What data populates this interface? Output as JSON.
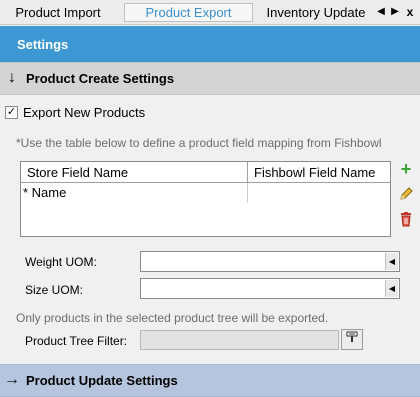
{
  "tabs": {
    "items": [
      {
        "label": "Product Import"
      },
      {
        "label": "Product Export"
      },
      {
        "label": "Inventory Update"
      }
    ],
    "active": "Product Export",
    "nav": {
      "prev": "◀",
      "next": "▶",
      "close": "x"
    }
  },
  "settings": {
    "title": "Settings"
  },
  "create_section": {
    "arrow": "↓",
    "title": "Product Create Settings"
  },
  "export_checkbox": {
    "label": "Export New Products",
    "checked": true,
    "mark": "✓"
  },
  "hint": "*Use the table below to define a product field mapping from Fishbowl",
  "mapping_table": {
    "columns": [
      "Store Field Name",
      "Fishbowl Field Name"
    ],
    "rows": [
      {
        "store_field": "* Name",
        "fishbowl_field": ""
      }
    ]
  },
  "side_actions": {
    "add": "+",
    "edit_icon": "pencil-icon",
    "delete_icon": "trash-icon"
  },
  "weight_uom": {
    "label": "Weight UOM:",
    "value": ""
  },
  "size_uom": {
    "label": "Size UOM:",
    "value": ""
  },
  "tree_note": "Only products in the selected product tree will be exported.",
  "tree_filter": {
    "label": "Product Tree Filter:",
    "value": ""
  },
  "update_section": {
    "arrow": "→",
    "title": "Product Update Settings"
  },
  "colors": {
    "accent": "#3d97d3",
    "active_tab_text": "#3b8fce",
    "add_green": "#3aa335",
    "delete_red": "#c0392b",
    "update_header": "#b5c5de"
  }
}
